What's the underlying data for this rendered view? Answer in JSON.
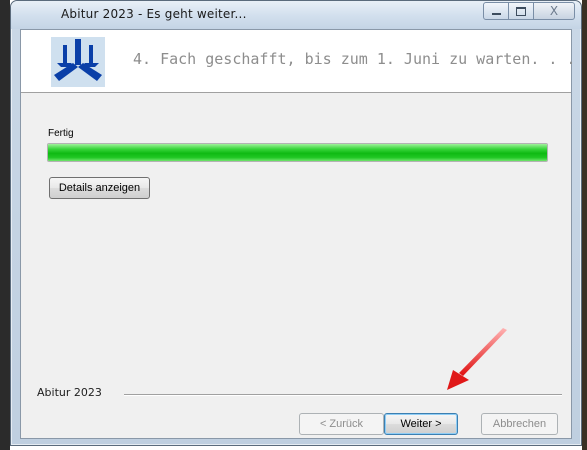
{
  "window": {
    "title": "Abitur 2023 - Es geht weiter...",
    "controls": {
      "minimize": "minimize",
      "maximize": "maximize",
      "close": "X"
    }
  },
  "header": {
    "text": "4. Fach geschafft, bis zum 1. Juni zu warten. . .",
    "logo_icon": "three-blade-logo"
  },
  "progress": {
    "label": "Fertig",
    "value": 1.0,
    "color": "#1dbd1f"
  },
  "buttons": {
    "details": "Details anzeigen",
    "back": "< Zurück",
    "next": "Weiter >",
    "cancel": "Abbrechen"
  },
  "footer": {
    "label": "Abitur 2023"
  },
  "annotation": {
    "arrow_color": "#e02020",
    "icon": "red-arrow-pointer"
  }
}
